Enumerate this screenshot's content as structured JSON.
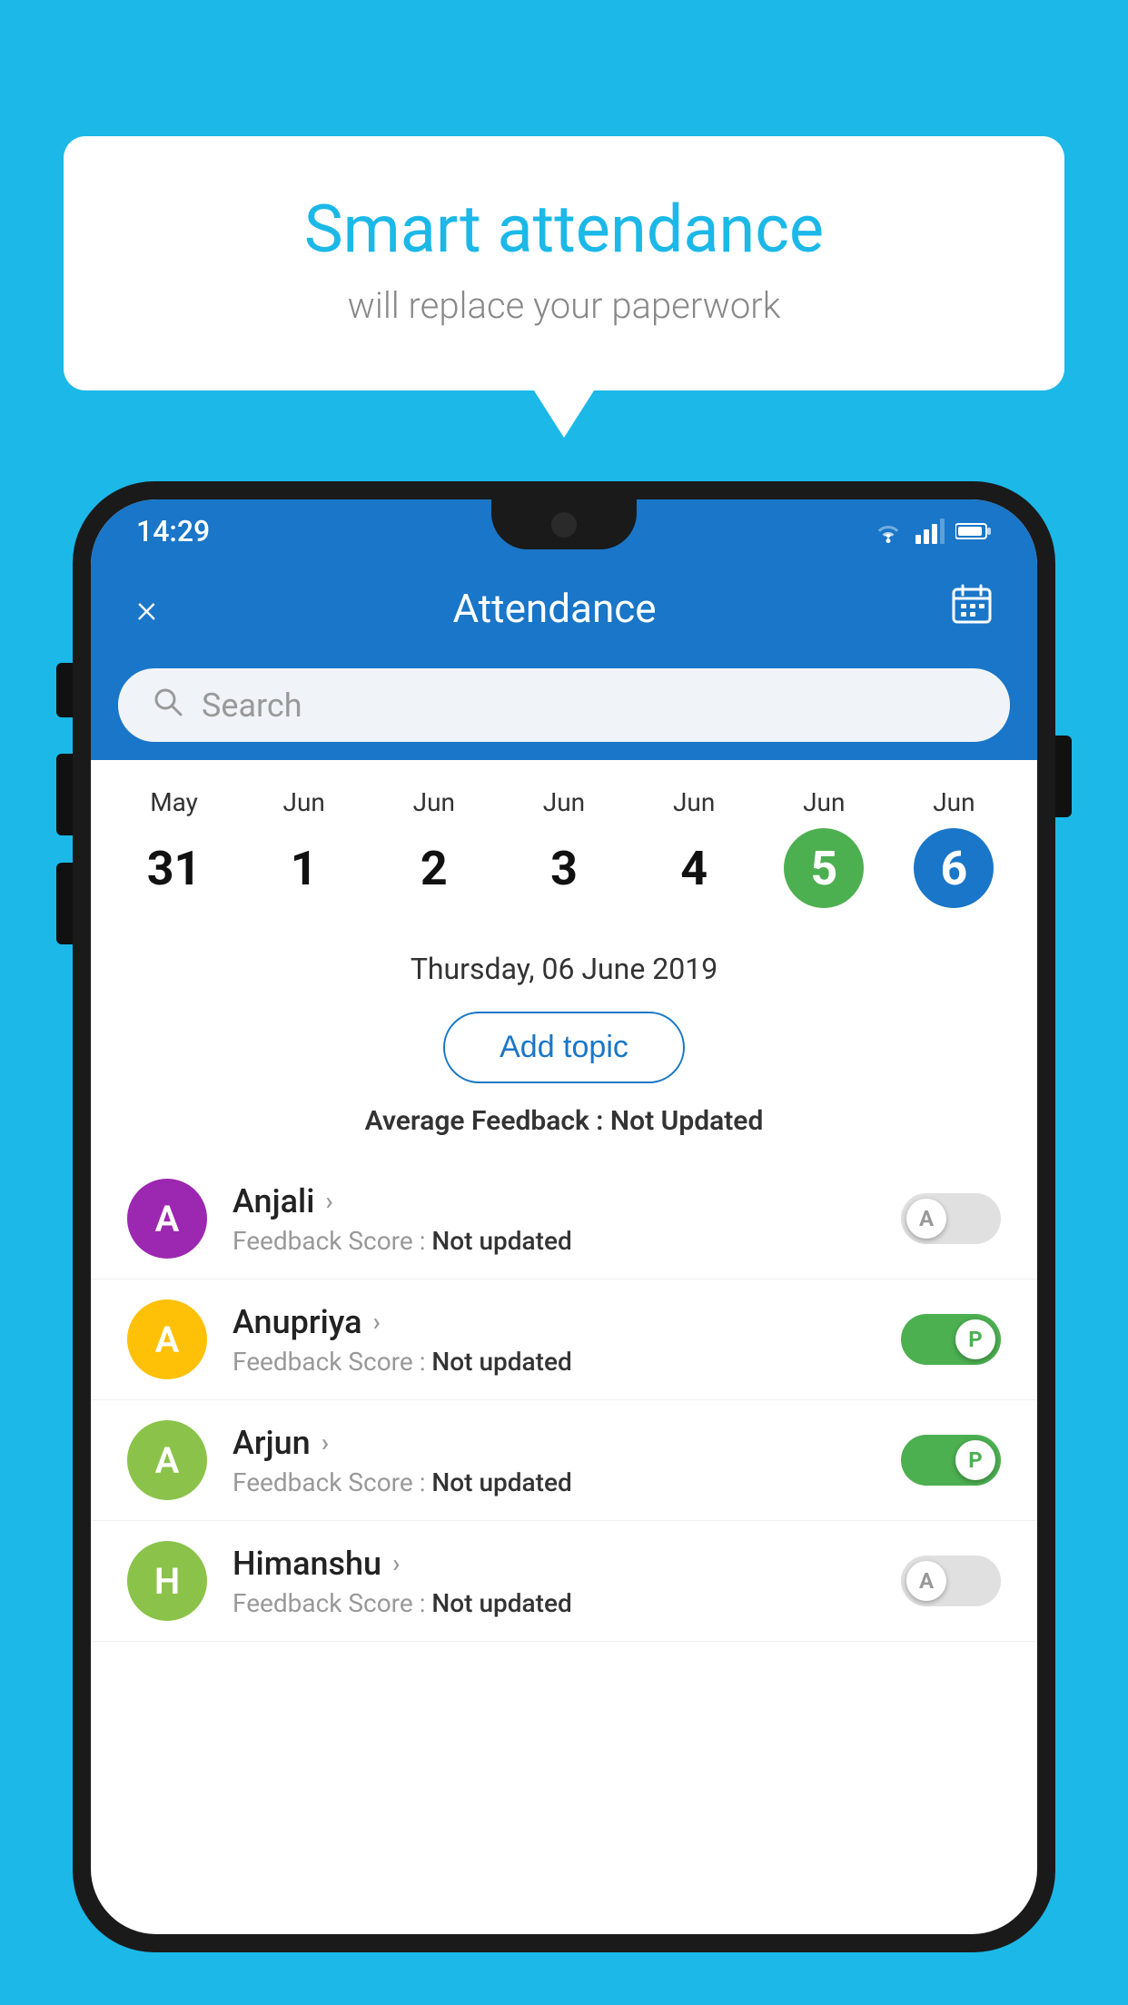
{
  "background_color": "#1BB8E8",
  "bubble": {
    "title": "Smart attendance",
    "subtitle": "will replace your paperwork"
  },
  "status_bar": {
    "time": "14:29",
    "icons": [
      "wifi",
      "signal",
      "battery"
    ]
  },
  "header": {
    "title": "Attendance",
    "close_label": "×",
    "calendar_icon": "calendar-icon"
  },
  "search": {
    "placeholder": "Search"
  },
  "calendar": {
    "days": [
      {
        "month": "May",
        "date": "31",
        "state": "normal"
      },
      {
        "month": "Jun",
        "date": "1",
        "state": "normal"
      },
      {
        "month": "Jun",
        "date": "2",
        "state": "normal"
      },
      {
        "month": "Jun",
        "date": "3",
        "state": "normal"
      },
      {
        "month": "Jun",
        "date": "4",
        "state": "normal"
      },
      {
        "month": "Jun",
        "date": "5",
        "state": "today"
      },
      {
        "month": "Jun",
        "date": "6",
        "state": "selected"
      }
    ]
  },
  "selected_date": "Thursday, 06 June 2019",
  "add_topic_label": "Add topic",
  "avg_feedback_label": "Average Feedback :",
  "avg_feedback_value": "Not Updated",
  "students": [
    {
      "name": "Anjali",
      "avatar_letter": "A",
      "avatar_color": "#9C27B0",
      "feedback_label": "Feedback Score :",
      "feedback_value": "Not updated",
      "attendance": "absent",
      "toggle_label": "A"
    },
    {
      "name": "Anupriya",
      "avatar_letter": "A",
      "avatar_color": "#FFC107",
      "feedback_label": "Feedback Score :",
      "feedback_value": "Not updated",
      "attendance": "present",
      "toggle_label": "P"
    },
    {
      "name": "Arjun",
      "avatar_letter": "A",
      "avatar_color": "#8BC34A",
      "feedback_label": "Feedback Score :",
      "feedback_value": "Not updated",
      "attendance": "present",
      "toggle_label": "P"
    },
    {
      "name": "Himanshu",
      "avatar_letter": "H",
      "avatar_color": "#8BC34A",
      "feedback_label": "Feedback Score :",
      "feedback_value": "Not updated",
      "attendance": "absent",
      "toggle_label": "A"
    }
  ]
}
